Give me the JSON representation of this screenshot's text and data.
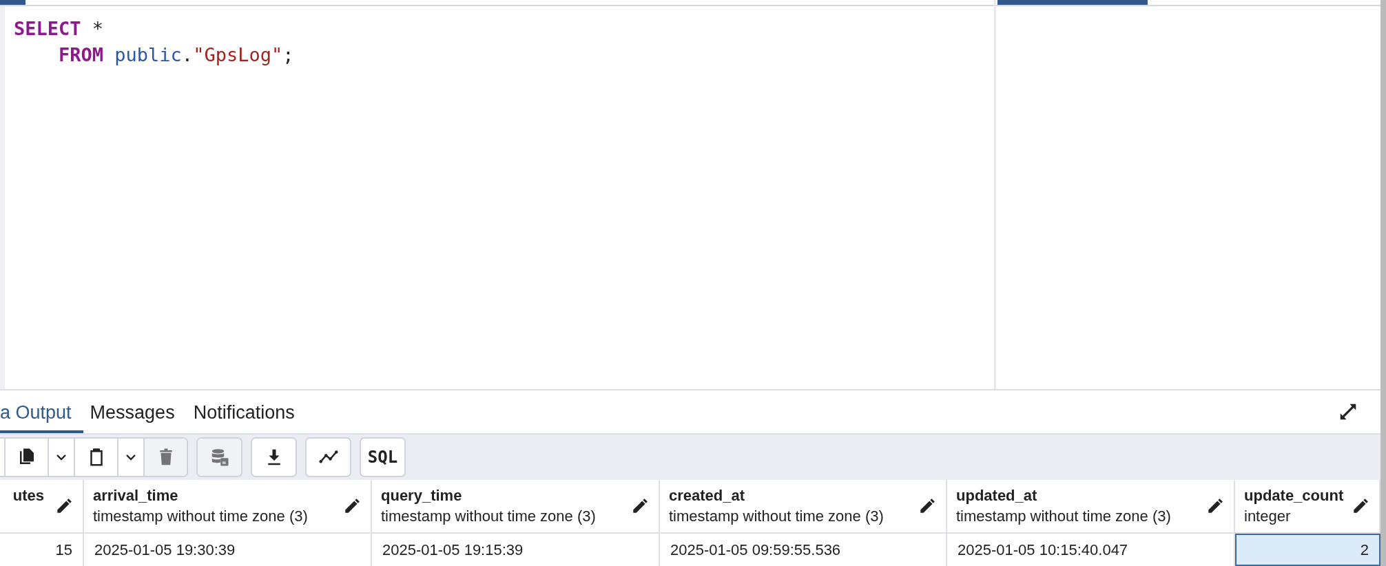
{
  "editor": {
    "lines": [
      {
        "tokens": [
          {
            "kind": "keyword",
            "text": "SELECT"
          },
          {
            "kind": "plain",
            "text": " *"
          }
        ]
      },
      {
        "tokens": [
          {
            "kind": "keyword",
            "text": "    FROM "
          },
          {
            "kind": "identifier",
            "text": "public"
          },
          {
            "kind": "plain",
            "text": "."
          },
          {
            "kind": "string",
            "text": "\"GpsLog\""
          },
          {
            "kind": "plain",
            "text": ";"
          }
        ]
      }
    ]
  },
  "output_tabs": [
    {
      "label": "a Output",
      "selected": true
    },
    {
      "label": "Messages",
      "selected": false
    },
    {
      "label": "Notifications",
      "selected": false
    }
  ],
  "toolbar": {
    "groups": [
      [
        {
          "kind": "copy",
          "disabled": false
        },
        {
          "kind": "dropdown",
          "disabled": false
        },
        {
          "kind": "paste",
          "disabled": false
        },
        {
          "kind": "dropdown",
          "disabled": false
        },
        {
          "kind": "delete",
          "disabled": true
        }
      ],
      [
        {
          "kind": "save-data",
          "disabled": true
        }
      ],
      [
        {
          "kind": "download",
          "disabled": false
        }
      ],
      [
        {
          "kind": "graph",
          "disabled": false
        }
      ],
      [
        {
          "kind": "sql",
          "label": "SQL",
          "disabled": false
        }
      ]
    ]
  },
  "table": {
    "columns": [
      {
        "name": "utes"
      },
      {
        "name": "arrival_time",
        "type": "timestamp without time zone (3)"
      },
      {
        "name": "query_time",
        "type": "timestamp without time zone (3)"
      },
      {
        "name": "created_at",
        "type": "timestamp without time zone (3)"
      },
      {
        "name": "updated_at",
        "type": "timestamp without time zone (3)"
      },
      {
        "name": "update_count",
        "type": "integer"
      }
    ],
    "rows": [
      [
        {
          "kind": "number",
          "text": "15",
          "selected": false
        },
        {
          "kind": "text",
          "text": "2025-01-05 19:30:39",
          "selected": false
        },
        {
          "kind": "text",
          "text": "2025-01-05 19:15:39",
          "selected": false
        },
        {
          "kind": "text",
          "text": "2025-01-05 09:59:55.536",
          "selected": false
        },
        {
          "kind": "text",
          "text": "2025-01-05 10:15:40.047",
          "selected": false
        },
        {
          "kind": "number",
          "text": "2",
          "selected": true
        }
      ]
    ]
  }
}
